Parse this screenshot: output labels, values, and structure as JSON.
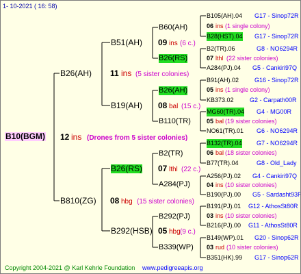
{
  "header": {
    "date_time": "1- 10-2021 ( 16: 58)"
  },
  "footer": {
    "copyright": "Copyright 2004-2021 @ Karl Kehrle Foundation",
    "site": "www.pedigreeapis.org"
  },
  "root": {
    "name": "B10(BGM)",
    "year": "12",
    "suffix": "ins",
    "note": "(Drones from 5 sister colonies)"
  },
  "father": {
    "name": "B26(AH)",
    "year": "11",
    "suffix": "ins",
    "note": "(5 sister colonies)"
  },
  "mother": {
    "name": "B810(ZG)",
    "year": "08",
    "suffix": "hbg",
    "note": "(15 sister colonies)"
  },
  "ff": {
    "name": "B51(AH)",
    "year": "09",
    "suffix": "ins",
    "note": "(6 c.)"
  },
  "fm": {
    "name": "B19(AH)",
    "year": "08",
    "suffix": "bal",
    "note": "(15 c.)"
  },
  "mf": {
    "name": "B26(RS)",
    "year": "07",
    "suffix": "lthl",
    "note": "(22 c.)"
  },
  "mm": {
    "name": "B292(HSB)",
    "year": "05",
    "suffix": "hbg",
    "note": "(9 c.)"
  },
  "fff": {
    "name": "B60(AH)"
  },
  "ffm": {
    "name": "B26(RS)"
  },
  "fmf": {
    "name": "B26(AH)"
  },
  "fmm": {
    "name": "B110(TR)"
  },
  "mff": {
    "name": "B2(TR)"
  },
  "mfm": {
    "name": "A284(PJ)"
  },
  "mmf": {
    "name": "B292(PJ)"
  },
  "mmm": {
    "name": "B339(WP)"
  },
  "g1": {
    "upper": "B105(AH).04",
    "upper_code": "G17 - Sinop72R",
    "year": "06",
    "suffix": "ins",
    "note": "(1 single colony)",
    "lower": "B28(HST).04",
    "lower_code": "G17 - Sinop72R"
  },
  "g2": {
    "upper": "B2(TR).06",
    "upper_code": "G8 - NO6294R",
    "year": "07",
    "suffix": "lthl",
    "note": "(22 sister colonies)",
    "lower": "A284(PJ).04",
    "lower_code": "G5 - Cankiri97Q"
  },
  "g3": {
    "upper": "B91(AH).02",
    "upper_code": "G16 - Sinop72R",
    "year": "05",
    "suffix": "ins",
    "note": "(1 single colony)",
    "lower": "KB373.02",
    "lower_code": "G2 - Carpath00R"
  },
  "g4": {
    "upper": "MG60(TR).04",
    "upper_code": "G4 - MG00R",
    "year": "05",
    "suffix": "bal",
    "note": "(19 sister colonies)",
    "lower": "NO61(TR).01",
    "lower_code": "G6 - NO6294R"
  },
  "g5": {
    "upper": "B132(TR).04",
    "upper_code": "G7 - NO6294R",
    "year": "06",
    "suffix": "bal",
    "note": "(18 sister colonies)",
    "lower": "B77(TR).04",
    "lower_code": "G8 - Old_Lady"
  },
  "g6": {
    "upper": "A256(PJ).02",
    "upper_code": "G4 - Cankiri97Q",
    "year": "04",
    "suffix": "ins",
    "note": "(10 sister colonies)",
    "lower": "B190(PJ).00",
    "lower_code": "G5 - Sardasht93R"
  },
  "g7": {
    "upper": "B191(PJ).01",
    "upper_code": "G12 - AthosSt80R",
    "year": "03",
    "suffix": "ins",
    "note": "(10 sister colonies)",
    "lower": "B216(PJ).00",
    "lower_code": "G11 - AthosSt80R"
  },
  "g8": {
    "upper": "B149(WP).01",
    "upper_code": "G20 - Sinop62R",
    "year": "03",
    "suffix": "rud",
    "note": "(10 sister colonies)",
    "lower": "B351(HK).99",
    "lower_code": "G17 - Sinop62R"
  },
  "colors": {
    "background": "#ffffe6",
    "highlight_green": "#22dd22",
    "root_pink": "#ffccff",
    "code_blue": "#0000ff",
    "ins_red": "#cc0000",
    "footer_green": "#008800"
  }
}
